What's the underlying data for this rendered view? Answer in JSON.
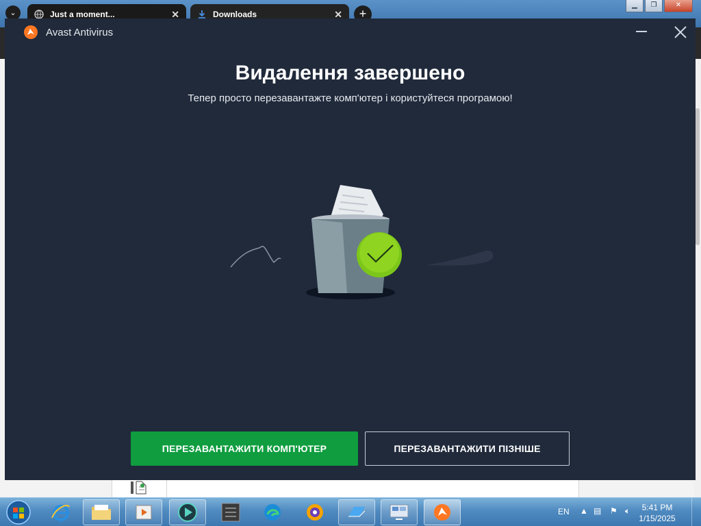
{
  "browser": {
    "tabs": [
      {
        "title": "Just a moment...",
        "favicon": "globe-icon"
      },
      {
        "title": "Downloads",
        "favicon": "download-icon"
      }
    ],
    "new_tab_label": "+",
    "tab_close_glyph": "✕"
  },
  "avast": {
    "app_title": "Avast Antivirus",
    "heading": "Видалення завершено",
    "subheading": "Тепер просто перезавантажте комп'ютер і користуйтеся програмою!",
    "primary_button": "ПЕРЕЗАВАНТАЖИТИ КОМП'ЮТЕР",
    "secondary_button": "ПЕРЕЗАВАНТАЖИТИ ПІЗНІШЕ",
    "colors": {
      "background": "#202a3b",
      "primary": "#0f9d3f",
      "check": "#7cc61a"
    }
  },
  "taskbar": {
    "items": [
      "start-orb",
      "internet-explorer",
      "file-explorer",
      "media-player",
      "media-app",
      "installer-app",
      "edge",
      "browser-app",
      "folder-app",
      "system-app",
      "avast"
    ],
    "language": "EN",
    "time": "5:41 PM",
    "date": "1/15/2025"
  }
}
